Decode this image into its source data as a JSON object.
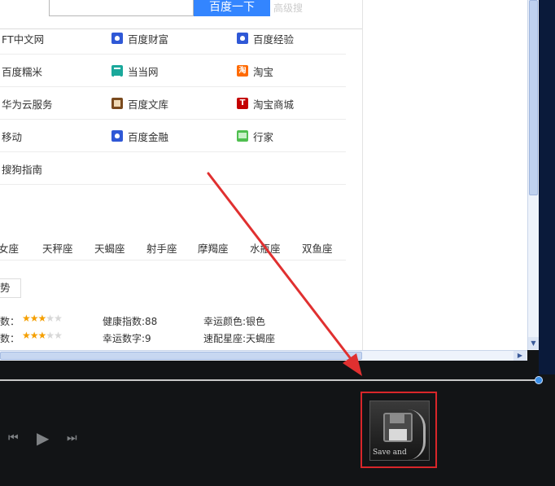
{
  "search": {
    "button_label": "百度一下",
    "faint_text": "高级搜"
  },
  "link_rows": [
    [
      "FT中文网",
      "百度财富",
      "百度经验"
    ],
    [
      "百度糯米",
      "当当网",
      "淘宝"
    ],
    [
      "华为云服务",
      "百度文库",
      "淘宝商城"
    ],
    [
      "移动",
      "百度金融",
      "行家"
    ],
    [
      "搜狗指南"
    ]
  ],
  "link_icons": [
    [
      null,
      "baidu",
      "baidu"
    ],
    [
      null,
      "dangdang",
      "taobao"
    ],
    [
      null,
      "wenku",
      "tmall"
    ],
    [
      null,
      "baidu",
      "hangjia"
    ],
    [
      null
    ]
  ],
  "zodiac": [
    "女座",
    "天秤座",
    "天蝎座",
    "射手座",
    "摩羯座",
    "水瓶座",
    "双鱼座"
  ],
  "horoscope": {
    "tab_label": "势",
    "row1": {
      "prefix": "数：",
      "stars_on": 3,
      "stars_total": 5,
      "health": "健康指数:88",
      "color": "幸运颜色:银色"
    },
    "row2": {
      "prefix": "数：",
      "stars_on": 3,
      "stars_total": 5,
      "number": "幸运数字:9",
      "match": "速配星座:天蝎座"
    }
  },
  "player": {
    "prev_icon": "⏮",
    "play_icon": "▶",
    "next_icon": "⏭",
    "seek_fraction": 1.0
  },
  "save_tile": {
    "label": "Save and",
    "icon": "floppy-disk-icon"
  },
  "colors": {
    "accent": "#3385ff",
    "highlight": "#d8262a",
    "star": "#f59f00"
  }
}
